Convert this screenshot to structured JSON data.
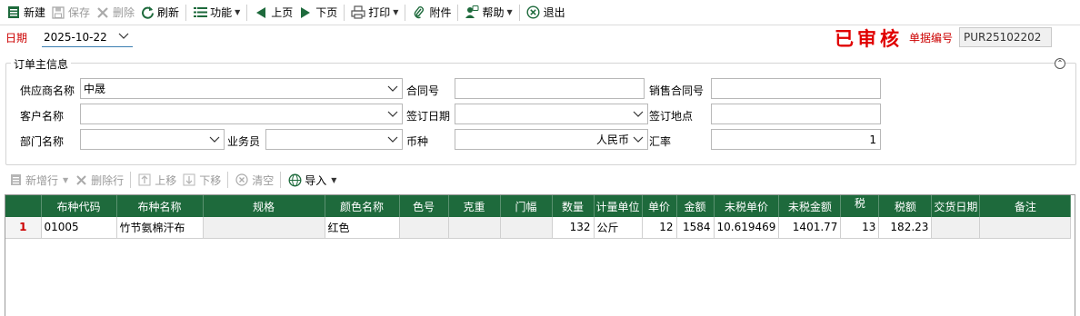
{
  "toolbar": {
    "new": "新建",
    "save": "保存",
    "delete": "删除",
    "refresh": "刷新",
    "function": "功能",
    "prev": "上页",
    "next": "下页",
    "print": "打印",
    "attach": "附件",
    "help": "帮助",
    "exit": "退出"
  },
  "header": {
    "date_label": "日期",
    "date_value": "2025-10-22",
    "stamp": "已审核",
    "docno_label": "单据编号",
    "docno_value": "PUR25102202"
  },
  "order": {
    "group_title": "订单主信息",
    "supplier_label": "供应商名称",
    "supplier_value": "中晟",
    "contract_label": "合同号",
    "contract_value": "",
    "sales_contract_label": "销售合同号",
    "sales_contract_value": "",
    "customer_label": "客户名称",
    "customer_value": "",
    "sign_date_label": "签订日期",
    "sign_date_value": "",
    "sign_place_label": "签订地点",
    "sign_place_value": "",
    "dept_label": "部门名称",
    "dept_value": "",
    "staff_label": "业务员",
    "staff_value": "",
    "currency_label": "币种",
    "currency_value": "人民币",
    "rate_label": "汇率",
    "rate_value": "1"
  },
  "grid_toolbar": {
    "add_row": "新增行",
    "delete_row": "删除行",
    "move_up": "上移",
    "move_down": "下移",
    "clear": "清空",
    "import": "导入"
  },
  "grid": {
    "columns": [
      "布种代码",
      "布种名称",
      "规格",
      "颜色名称",
      "色号",
      "克重",
      "门幅",
      "数量",
      "计量单位",
      "单价",
      "金额",
      "未税单价",
      "未税金额",
      "税",
      "税额",
      "交货日期",
      "备注"
    ],
    "rows": [
      {
        "row_no": "1",
        "code": "01005",
        "name": "竹节氨棉汗布",
        "spec": "",
        "color": "红色",
        "color_no": "",
        "weight": "",
        "width": "",
        "qty": "132",
        "unit": "公斤",
        "price": "12",
        "amount": "1584",
        "untaxed_price": "10.619469",
        "untaxed_amount": "1401.77",
        "tax_rate": "13",
        "tax": "182.23",
        "delivery_date": "",
        "remark": ""
      }
    ]
  },
  "colors": {
    "header_green": "#1e6a3c",
    "accent_red": "#cc0000",
    "stamp_red": "#e00000"
  }
}
